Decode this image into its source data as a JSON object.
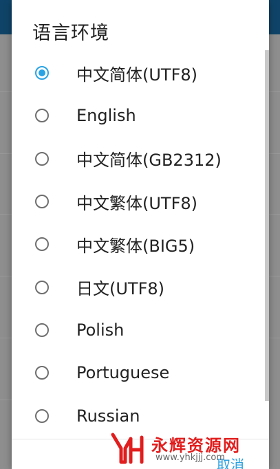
{
  "dialog": {
    "title": "语言环境",
    "selected_index": 0,
    "options": [
      {
        "label": "中文简体(UTF8)",
        "checked": true
      },
      {
        "label": "English",
        "checked": false
      },
      {
        "label": "中文简体(GB2312)",
        "checked": false
      },
      {
        "label": "中文繁体(UTF8)",
        "checked": false
      },
      {
        "label": "中文繁体(BIG5)",
        "checked": false
      },
      {
        "label": "日文(UTF8)",
        "checked": false
      },
      {
        "label": "Polish",
        "checked": false
      },
      {
        "label": "Portuguese",
        "checked": false
      },
      {
        "label": "Russian",
        "checked": false
      }
    ],
    "cancel_label": "取消"
  },
  "watermark": {
    "title": "永辉资源网",
    "url": "www.yhkjjj.com"
  },
  "colors": {
    "accent": "#29a3e4",
    "app_bar": "#0f4468",
    "watermark_red": "#e11e1e"
  }
}
